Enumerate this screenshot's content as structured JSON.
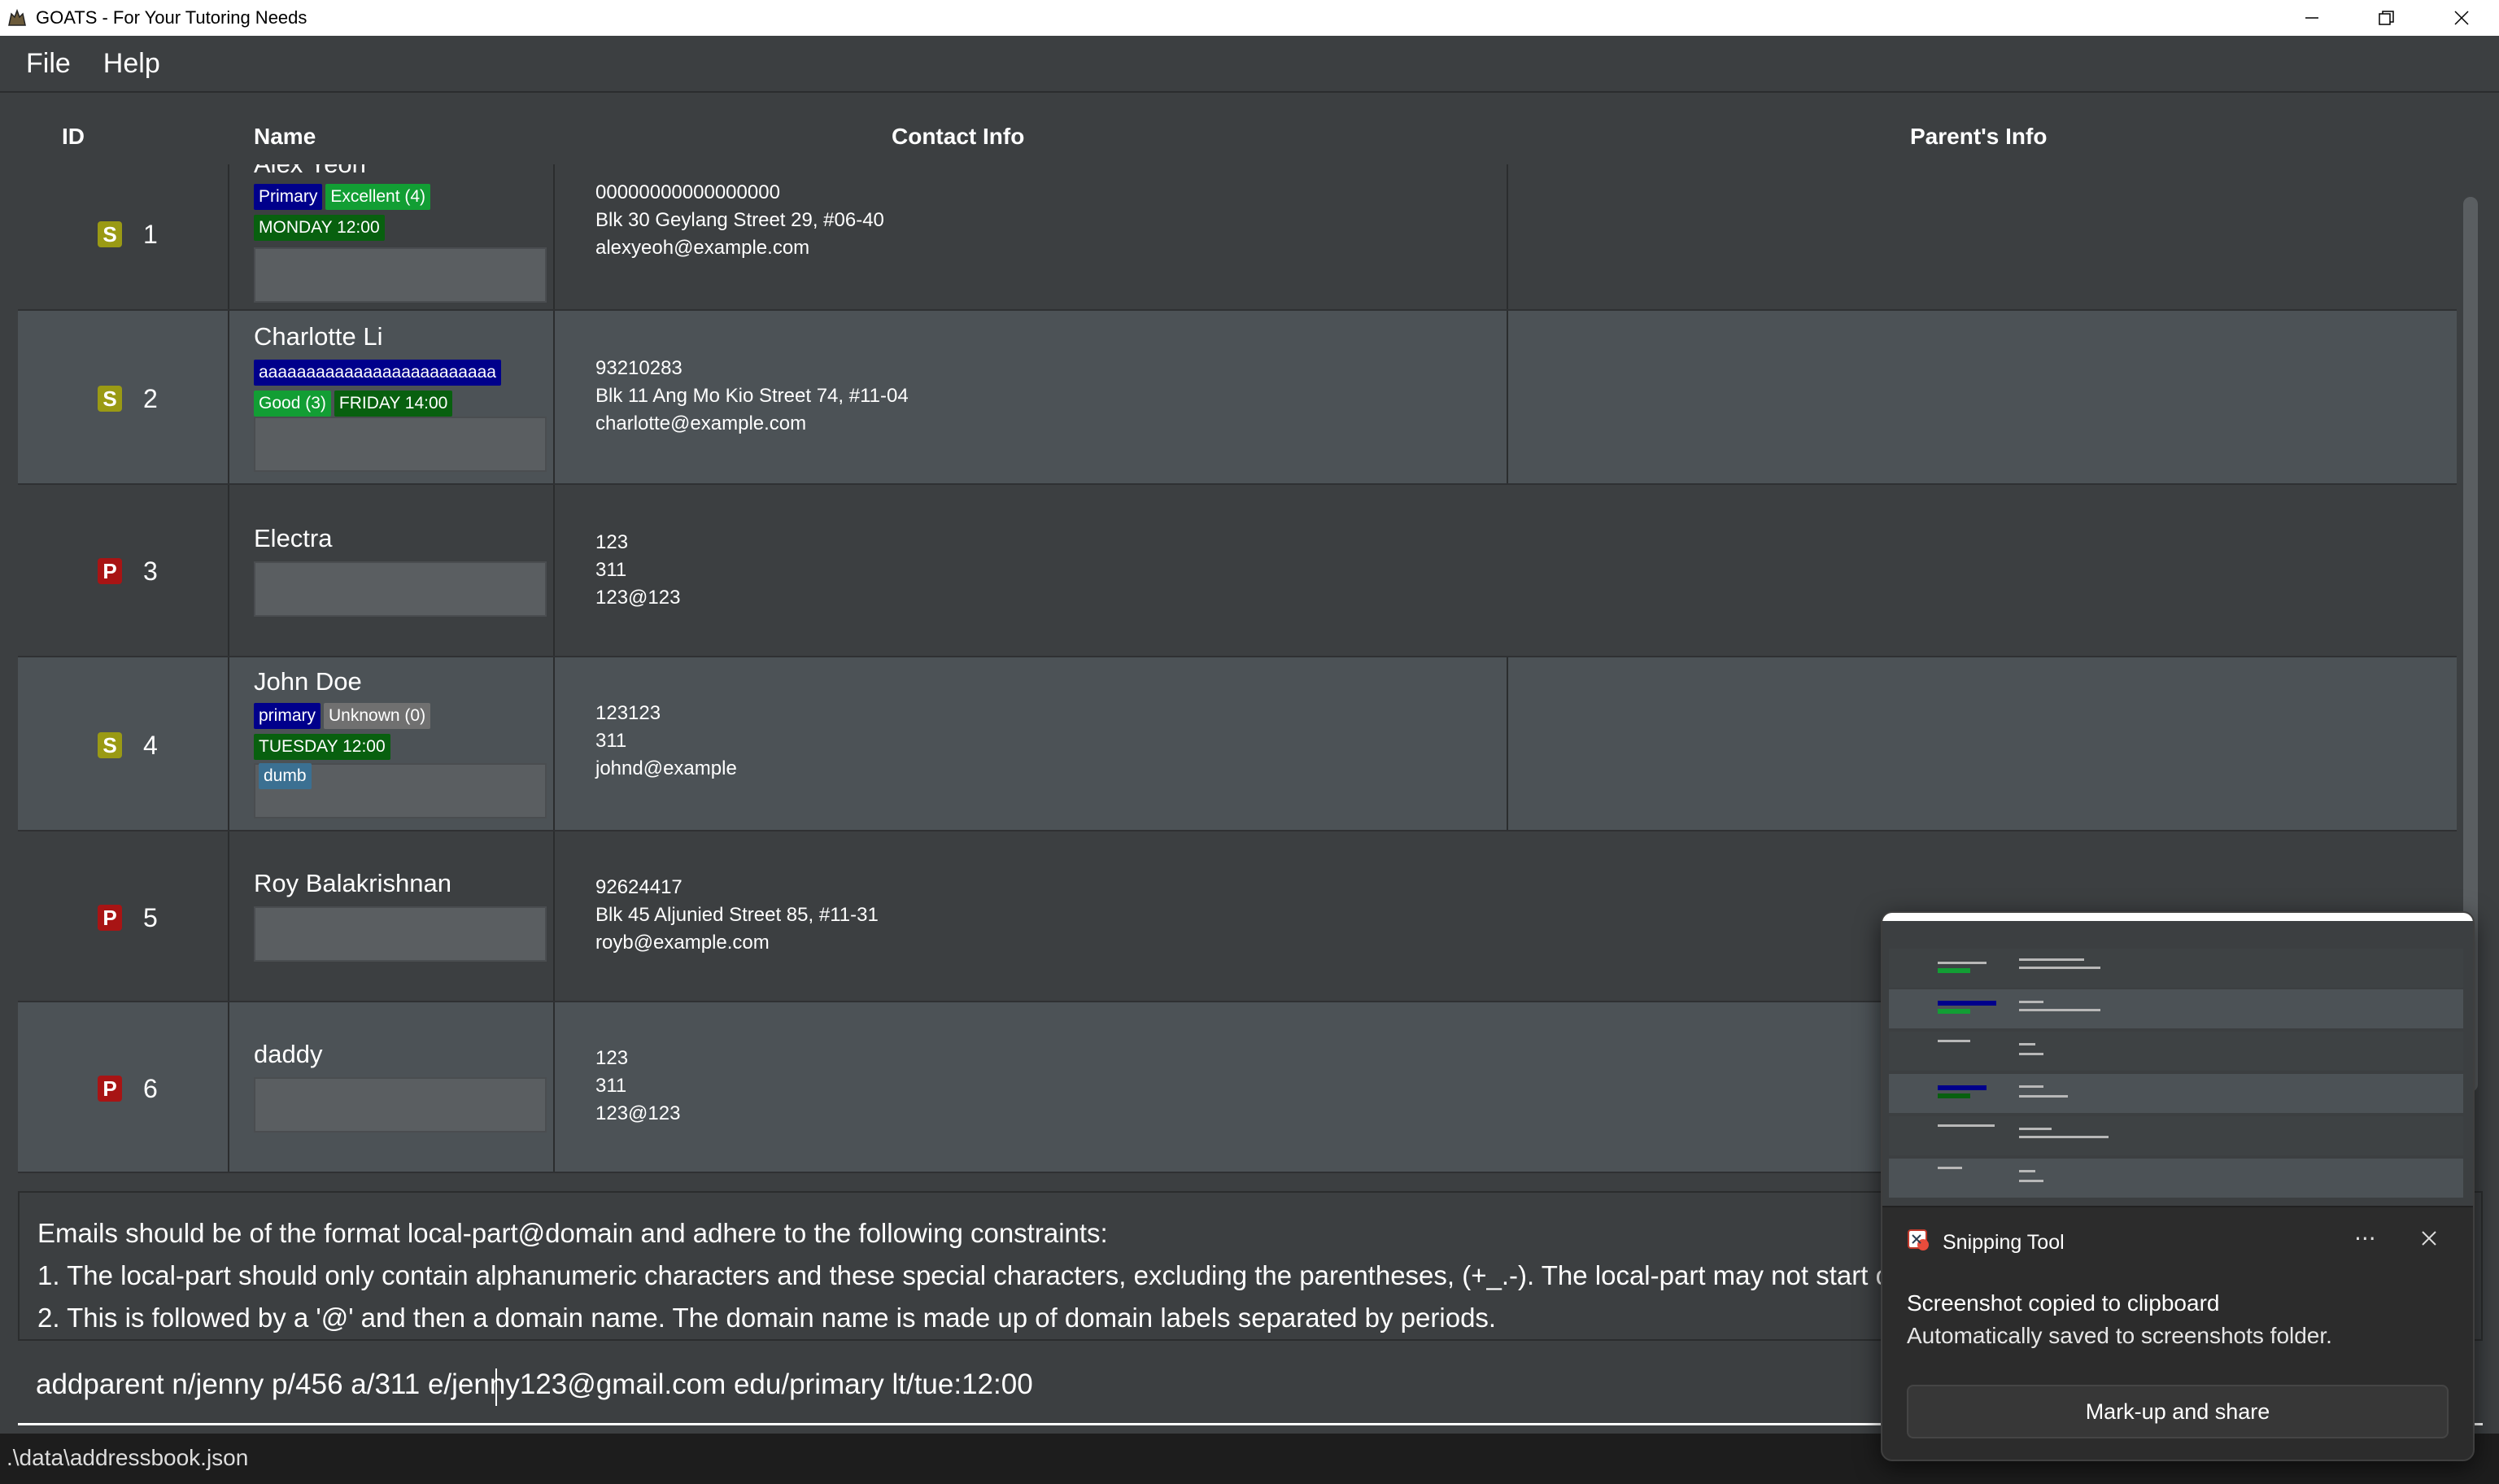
{
  "window": {
    "title": "GOATS - For Your Tutoring Needs"
  },
  "menu": {
    "file": "File",
    "help": "Help"
  },
  "table": {
    "headers": {
      "id": "ID",
      "name": "Name",
      "contact": "Contact Info",
      "parent": "Parent's Info"
    },
    "rows": [
      {
        "type": "S",
        "id": "1",
        "name": "Alex Yeoh",
        "tags": [
          "Primary",
          "Excellent (4)",
          "MONDAY 12:00"
        ],
        "phone": "00000000000000000",
        "address": "Blk 30 Geylang Street 29, #06-40",
        "email": "alexyeoh@example.com"
      },
      {
        "type": "S",
        "id": "2",
        "name": "Charlotte Li",
        "tags": [
          "aaaaaaaaaaaaaaaaaaaaaaaaa",
          "Good (3)",
          "FRIDAY 14:00"
        ],
        "phone": "93210283",
        "address": "Blk 11 Ang Mo Kio Street 74, #11-04",
        "email": "charlotte@example.com"
      },
      {
        "type": "P",
        "id": "3",
        "name": "Electra",
        "tags": [],
        "phone": "123",
        "address": "311",
        "email": "123@123"
      },
      {
        "type": "S",
        "id": "4",
        "name": "John Doe",
        "tags": [
          "primary",
          "Unknown (0)",
          "TUESDAY 12:00",
          "dumb"
        ],
        "phone": "123123",
        "address": "311",
        "email": "johnd@example"
      },
      {
        "type": "P",
        "id": "5",
        "name": "Roy Balakrishnan",
        "tags": [],
        "phone": "92624417",
        "address": "Blk 45 Aljunied Street 85, #11-31",
        "email": "royb@example.com"
      },
      {
        "type": "P",
        "id": "6",
        "name": "daddy",
        "tags": [],
        "phone": "123",
        "address": "311",
        "email": "123@123"
      }
    ]
  },
  "result": {
    "line1": "Emails should be of the format local-part@domain and adhere to the following constraints:",
    "line2": "1. The local-part should only contain alphanumeric characters and these special characters, excluding the parentheses, (+_.-). The local-part may not start or end with any special characters.",
    "line3": "2. This is followed by a '@' and then a domain name. The domain name is made up of domain labels separated by periods."
  },
  "command": {
    "value": "addparent n/jenny p/456 a/311 e/jenny123@gmail.com edu/primary lt/tue:12:00"
  },
  "status": {
    "path": ".\\data\\addressbook.json"
  },
  "toast": {
    "app_name": "Snipping Tool",
    "more": "···",
    "title": "Screenshot copied to clipboard",
    "body": "Automatically saved to screenshots folder.",
    "button": "Mark-up and share"
  },
  "colors": {
    "background": "#3c3f41",
    "row_alt": "#4c5256",
    "student_badge": "#9a9a14",
    "parent_badge": "#a81414",
    "tag_navy": "#00008b",
    "tag_green": "#129e34",
    "tag_darkgreen": "#08600f"
  }
}
